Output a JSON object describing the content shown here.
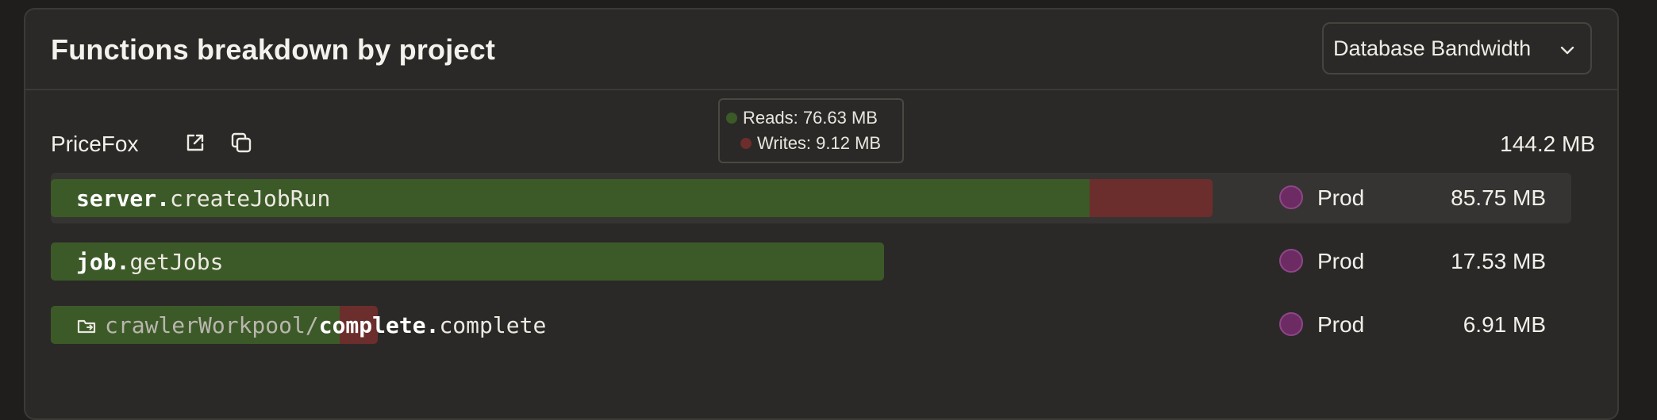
{
  "panel": {
    "title": "Functions breakdown by project",
    "metric_select": {
      "value": "Database Bandwidth"
    }
  },
  "project": {
    "name": "PriceFox",
    "total": "144.2 MB",
    "open_icon": "external-link-icon",
    "copy_icon": "copy-icon"
  },
  "tooltip": {
    "reads": "Reads: 76.63 MB",
    "writes": "Writes: 9.12 MB",
    "reads_color": "#3c5a28",
    "writes_color": "#6b2e2d"
  },
  "functions": [
    {
      "module": "server.",
      "name": "createJobRun",
      "env": "Prod",
      "value": "85.75 MB",
      "reads_fraction": 0.683,
      "writes_fraction": 0.081
    },
    {
      "module": "job.",
      "name": "getJobs",
      "env": "Prod",
      "value": "17.53 MB",
      "reads_fraction": 0.548,
      "writes_fraction": 0.0
    },
    {
      "path": "crawlerWorkpool/",
      "module": "complete.",
      "name": "complete",
      "env": "Prod",
      "value": "6.91 MB",
      "reads_fraction": 0.19,
      "writes_fraction": 0.025,
      "icon": "folder-icon"
    }
  ],
  "colors": {
    "reads": "#3c5a28",
    "writes": "#6b2e2d",
    "env_dot": "#6c2b63"
  }
}
